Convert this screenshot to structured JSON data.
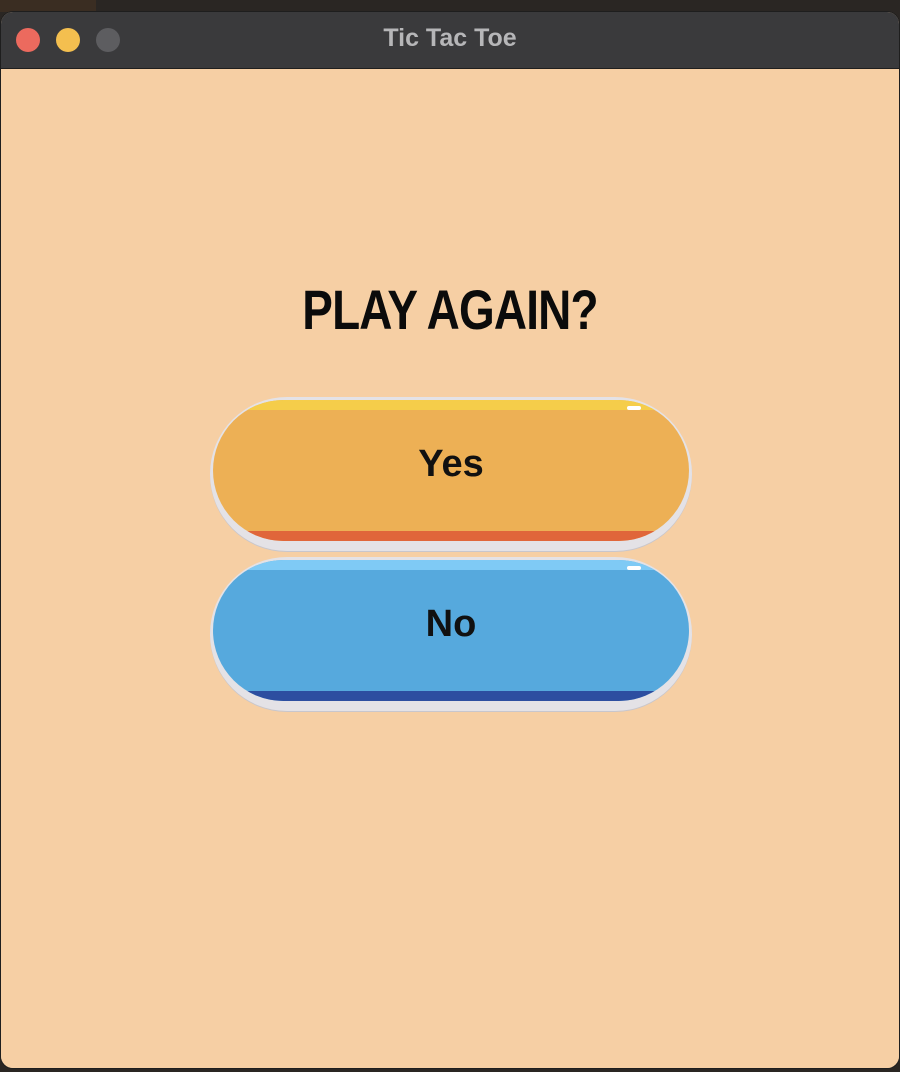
{
  "window": {
    "title": "Tic Tac Toe",
    "controls": [
      {
        "name": "close",
        "color": "#ec6a5e"
      },
      {
        "name": "minimize",
        "color": "#f4bf4f"
      },
      {
        "name": "maximize",
        "color": "#5d5d60"
      }
    ]
  },
  "dialog": {
    "heading": "PLAY AGAIN?",
    "yes_label": "Yes",
    "no_label": "No"
  },
  "colors": {
    "background": "#f6cfa4",
    "yes_fill": "#edb055",
    "yes_top": "#f5cd4a",
    "yes_bottom": "#e0663a",
    "no_fill": "#56a9dd",
    "no_top": "#7fcaf5",
    "no_bottom": "#2d4ea0"
  }
}
